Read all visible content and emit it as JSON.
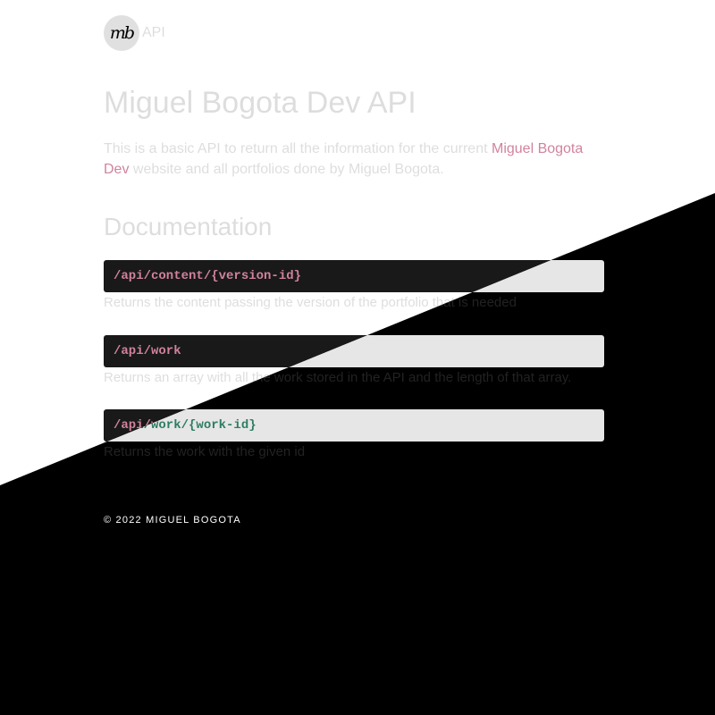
{
  "header": {
    "logo_text": "mb",
    "label": "API"
  },
  "main": {
    "title": "Miguel Bogota Dev API",
    "intro_before": "This is a basic API to return all the information for the current ",
    "intro_link": "Miguel Bogota Dev",
    "intro_after": " website and all portfolios done by Miguel Bogota.",
    "section_title": "Documentation"
  },
  "endpoints": [
    {
      "path": "/api/content/{version-id}",
      "description": "Returns the content passing the version of the portfolio that is needed"
    },
    {
      "path": "/api/work",
      "description": "Returns an array with all the work stored in the API and the length of that array."
    },
    {
      "path": "/api/work/{work-id}",
      "description": "Returns the work with the given id"
    }
  ],
  "footer": {
    "copyright": "© 2022 MIGUEL BOGOTA"
  },
  "colors": {
    "accent": "#2e7d63",
    "text": "#222222",
    "code_bg": "#e6e6e6",
    "dark_bg": "#000000"
  }
}
